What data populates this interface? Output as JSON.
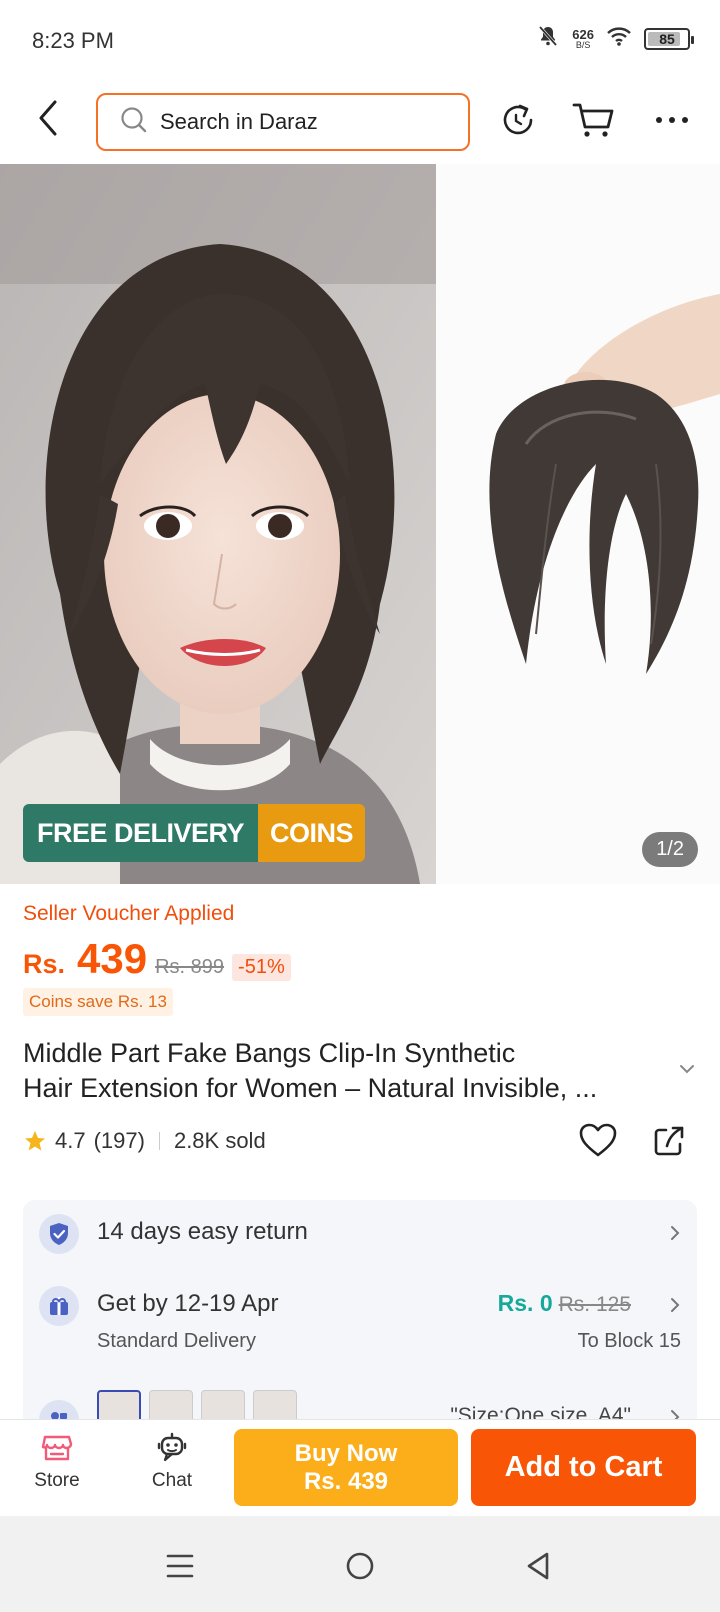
{
  "status_bar": {
    "time": "8:23 PM",
    "net_speed": "626",
    "net_unit": "B/S",
    "battery": "85",
    "battery_level": 0.85
  },
  "header": {
    "search_placeholder": "Search in Daraz",
    "icons": [
      "back-arrow-icon",
      "search-icon",
      "refresh-icon",
      "cart-icon",
      "more-icon"
    ]
  },
  "gallery": {
    "promo_free_delivery": "FREE DELIVERY",
    "promo_coins": "COINS",
    "pager": "1/2"
  },
  "product": {
    "voucher": "Seller Voucher Applied",
    "currency": "Rs.",
    "price": "439",
    "original_price": "Rs. 899",
    "discount": "-51%",
    "coins_save": "Coins save Rs. 13",
    "title_line1": "Middle Part Fake Bangs Clip-In Synthetic",
    "title_line2": "Hair Extension for Women – Natural Invisible, ...",
    "rating": "4.7",
    "reviews": "(197)",
    "sold": "2.8K sold"
  },
  "info": {
    "return": "14 days easy return",
    "delivery": "Get by 12-19 Apr",
    "delivery_type": "Standard Delivery",
    "fee_now": "Rs. 0",
    "fee_was": "Rs. 125",
    "location": "To Block 15",
    "variant": "\"Size:One size, A4\""
  },
  "actions": {
    "store": "Store",
    "chat": "Chat",
    "buy_now_line1": "Buy Now",
    "buy_now_line2": "Rs. 439",
    "add_to_cart": "Add to Cart"
  },
  "colors": {
    "accent": "#f85606",
    "buy_now": "#fbad1a",
    "free_delivery": "#2f7a66",
    "coins": "#e89a10",
    "delivery_fee": "#16a89a"
  }
}
